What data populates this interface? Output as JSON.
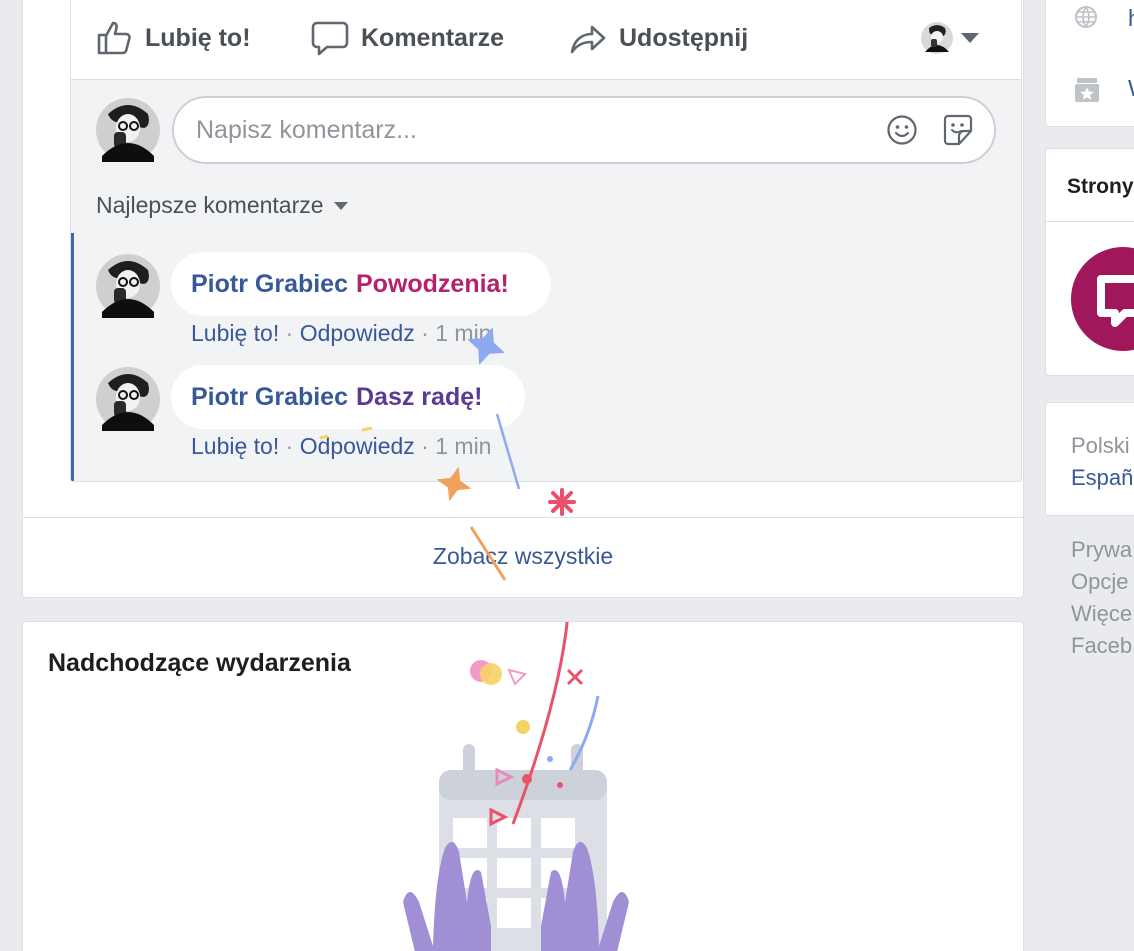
{
  "post": {
    "actions": {
      "like": "Lubię to!",
      "comment": "Komentarze",
      "share": "Udostępnij"
    },
    "composer": {
      "placeholder": "Napisz komentarz..."
    },
    "sort_label": "Najlepsze komentarze",
    "comments": [
      {
        "author": "Piotr Grabiec",
        "text": "Powodzenia!",
        "like": "Lubię to!",
        "reply": "Odpowiedz",
        "sep": "·",
        "time": "1 min"
      },
      {
        "author": "Piotr Grabiec",
        "text": "Dasz radę!",
        "like": "Lubię to!",
        "reply": "Odpowiedz",
        "sep": "·",
        "time": "1 min"
      }
    ],
    "see_all": "Zobacz wszystkie"
  },
  "events": {
    "title": "Nadchodzące wydarzenia"
  },
  "right": {
    "links": [
      "h",
      "W"
    ],
    "pages_header": "Strony",
    "languages": [
      "Polski",
      "Españ"
    ],
    "footer": [
      "Prywa",
      "Opcje",
      "Więce",
      "Faceb"
    ]
  },
  "colors": {
    "link": "#385898",
    "comment1_text": "#b3226b",
    "comment2_text": "#5b3a93",
    "thread_bar": "#4267b2",
    "page_logo": "#a0175b",
    "hands": "#a18fd6"
  },
  "icons": {
    "like": "thumbs-up-icon",
    "comment": "speech-bubble-icon",
    "share": "share-arrow-icon",
    "emoji": "smiley-icon",
    "sticker": "sticker-icon",
    "globe": "globe-icon",
    "shop": "shop-icon"
  }
}
